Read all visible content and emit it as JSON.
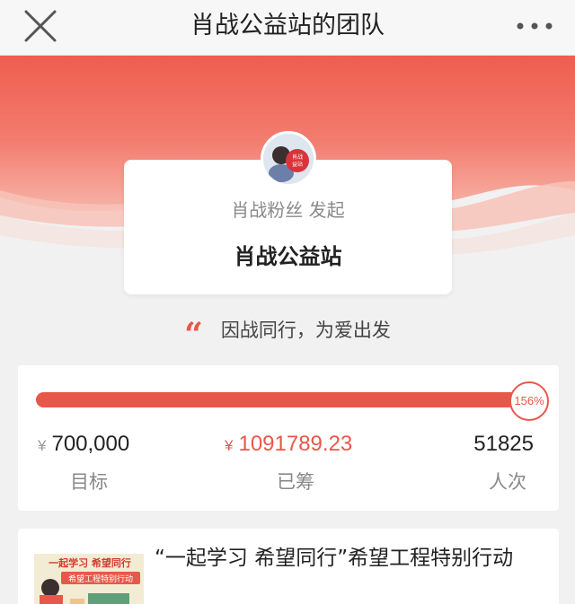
{
  "navbar": {
    "title": "肖战公益站的团队",
    "close_icon": "close-icon",
    "more_icon": "more-icon"
  },
  "team": {
    "initiator": "肖战粉丝 发起",
    "name": "肖战公益站",
    "avatar_text": "肖战\n益站",
    "slogan": "因战同行，为爱出发"
  },
  "progress": {
    "percent_label": "156%",
    "percent": 156,
    "goal_currency": "¥",
    "goal_value": "700,000",
    "goal_label": "目标",
    "raised_currency": "¥",
    "raised_value": "1091789.23",
    "raised_label": "已筹",
    "count_value": "51825",
    "count_label": "人次"
  },
  "project": {
    "title": "“一起学习 希望同行”希望工程特别行动",
    "thumb_line1": "一起学习 希望同行",
    "thumb_line2": "希望工程特别行动"
  },
  "colors": {
    "accent": "#e8584a",
    "hero_top": "#ef5d4f",
    "hero_mid": "#f7b4a8",
    "page_bg": "#f1f1f1"
  }
}
